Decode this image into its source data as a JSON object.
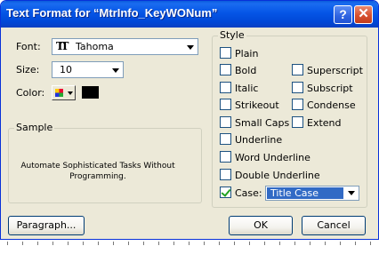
{
  "window": {
    "title": "Text Format for “MtrInfo_KeyWONum”"
  },
  "titlebar": {
    "help_label": "?",
    "close_label": "✕"
  },
  "font": {
    "label": "Font:",
    "value": "Tahoma",
    "icon": "truetype-font-icon"
  },
  "size": {
    "label": "Size:",
    "value": "10"
  },
  "color": {
    "label": "Color:",
    "value": "#000000"
  },
  "sample": {
    "legend": "Sample",
    "text": "Automate Sophisticated Tasks Without Programming."
  },
  "style": {
    "legend": "Style",
    "options": [
      {
        "label": "Plain",
        "checked": false
      },
      {
        "label": "Bold",
        "checked": false
      },
      {
        "label": "Superscript",
        "checked": false
      },
      {
        "label": "Italic",
        "checked": false
      },
      {
        "label": "Subscript",
        "checked": false
      },
      {
        "label": "Strikeout",
        "checked": false
      },
      {
        "label": "Condense",
        "checked": false
      },
      {
        "label": "Small Caps",
        "checked": false
      },
      {
        "label": "Extend",
        "checked": false
      },
      {
        "label": "Underline",
        "checked": false
      },
      {
        "label": "Word Underline",
        "checked": false
      },
      {
        "label": "Double Underline",
        "checked": false
      },
      {
        "label": "Case:",
        "checked": true
      }
    ],
    "case_value": "Title Case"
  },
  "buttons": {
    "paragraph": "Paragraph...",
    "ok": "OK",
    "cancel": "Cancel"
  }
}
